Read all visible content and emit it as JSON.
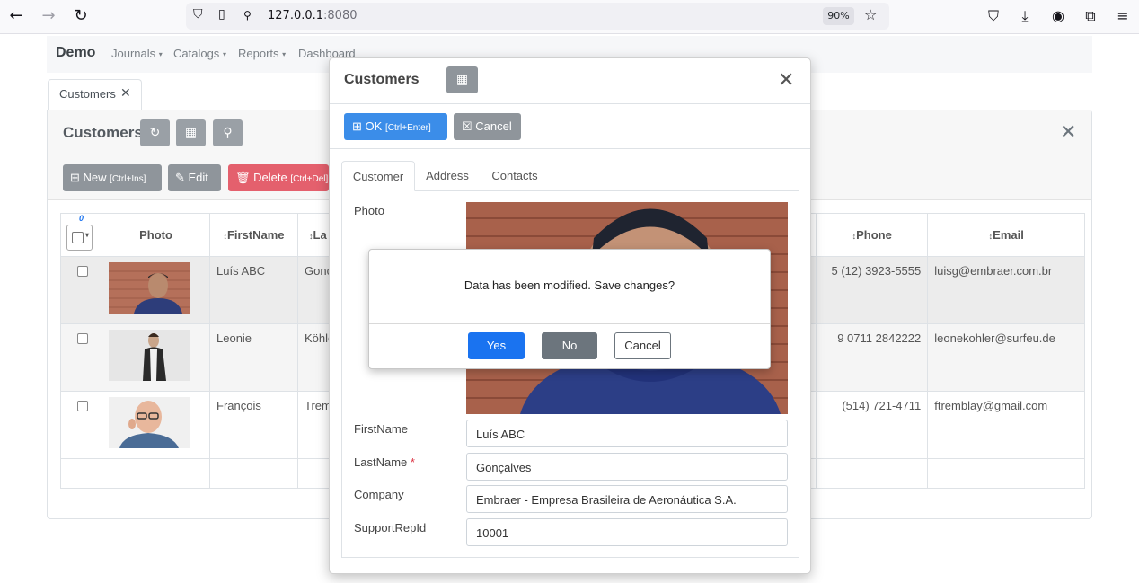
{
  "browser": {
    "url_host": "127.0.0.1",
    "url_port": ":8080",
    "zoom": "90%"
  },
  "navbar": {
    "brand": "Demo",
    "menus": [
      "Journals",
      "Catalogs",
      "Reports",
      "Dashboard"
    ]
  },
  "doc_tab": {
    "label": "Customers"
  },
  "panel": {
    "title": "Customers",
    "toolbar": {
      "new_label": "New",
      "new_shortcut": "[Ctrl+Ins]",
      "edit_label": "Edit",
      "delete_label": "Delete",
      "delete_shortcut": "[Ctrl+Del]"
    },
    "select_count": "0",
    "columns": [
      "Photo",
      "FirstName",
      "La",
      "Phone",
      "Email"
    ],
    "rows": [
      {
        "first": "Luís ABC",
        "last": "Gonç",
        "phone": "5 (12) 3923-5555",
        "email": "luisg@embraer.com.br"
      },
      {
        "first": "Leonie",
        "last": "Köhle",
        "phone": "9 0711 2842222",
        "email": "leonekohler@surfeu.de"
      },
      {
        "first": "François",
        "last": "Trem",
        "phone": "(514) 721-4711",
        "email": "ftremblay@gmail.com"
      }
    ]
  },
  "modal": {
    "title": "Customers",
    "ok_label": "OK",
    "ok_shortcut": "[Ctrl+Enter]",
    "cancel_label": "Cancel",
    "tabs": [
      "Customer",
      "Address",
      "Contacts"
    ],
    "fields": {
      "photo_label": "Photo",
      "firstname_label": "FirstName",
      "firstname_value": "Luís ABC",
      "lastname_label": "LastName",
      "lastname_value": "Gonçalves",
      "company_label": "Company",
      "company_value": "Embraer - Empresa Brasileira de Aeronáutica S.A.",
      "supportrep_label": "SupportRepId",
      "supportrep_value": "10001"
    }
  },
  "confirm": {
    "message": "Data has been modified. Save changes?",
    "yes": "Yes",
    "no": "No",
    "cancel": "Cancel"
  },
  "colors": {
    "primary": "#1a73f0",
    "secondary": "#6c757d",
    "danger": "#e4606d",
    "button_gray": "#8f959b"
  }
}
